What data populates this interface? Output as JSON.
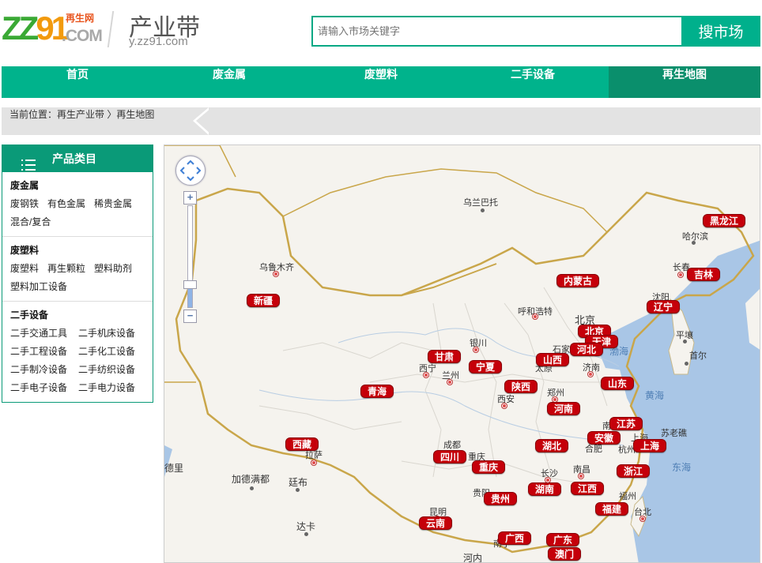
{
  "header": {
    "logo_main": "ZZ91",
    "logo_com": ".COM",
    "logo_tag": "再生网",
    "site_title": "产业带",
    "site_url": "y.zz91.com",
    "search_placeholder": "请输入市场关键字",
    "search_button": "搜市场"
  },
  "nav": {
    "items": [
      {
        "label": "首页"
      },
      {
        "label": "废金属"
      },
      {
        "label": "废塑料"
      },
      {
        "label": "二手设备"
      },
      {
        "label": "再生地图",
        "active": true
      }
    ]
  },
  "breadcrumb": {
    "text": "当前位置：再生产业带 〉再生地图"
  },
  "sidebar": {
    "title": "产品类目",
    "sections": [
      {
        "title": "废金属",
        "items": [
          "废钢铁",
          "有色金属",
          "稀贵金属",
          "混合/复合"
        ]
      },
      {
        "title": "废塑料",
        "items": [
          "废塑料",
          "再生颗粒",
          "塑料助剂",
          "塑料加工设备"
        ]
      },
      {
        "title": "二手设备",
        "items": [
          "二手交通工具",
          "二手机床设备",
          "二手工程设备",
          "二手化工设备",
          "二手制冷设备",
          "二手纺织设备",
          "二手电子设备",
          "二手电力设备"
        ]
      }
    ]
  },
  "map": {
    "zoom_in": "+",
    "zoom_out": "−",
    "provinces": [
      "黑龙江",
      "吉林",
      "辽宁",
      "内蒙古",
      "新疆",
      "北京",
      "天津",
      "河北",
      "山西",
      "甘肃",
      "宁夏",
      "青海",
      "陕西",
      "山东",
      "河南",
      "江苏",
      "安徽",
      "上海",
      "西藏",
      "湖北",
      "四川",
      "重庆",
      "浙江",
      "湖南",
      "江西",
      "贵州",
      "福建",
      "云南",
      "广西",
      "广东",
      "澳门"
    ],
    "cities": [
      "乌兰巴托",
      "哈尔滨",
      "长春",
      "沈阳",
      "乌鲁木齐",
      "呼和浩特",
      "北京",
      "平壤",
      "首尔",
      "银川",
      "石家",
      "济南",
      "西宁",
      "兰州",
      "太原",
      "郑州",
      "西安",
      "成都",
      "重庆",
      "合肥",
      "南京",
      "杭州",
      "上海",
      "苏老礁",
      "南昌",
      "长沙",
      "贵阳",
      "福州",
      "台北",
      "昆明",
      "拉萨",
      "加德满都",
      "廷布",
      "达卡",
      "南宁",
      "河内",
      "德里"
    ],
    "seas": [
      "渤海",
      "黄海",
      "东海"
    ]
  }
}
